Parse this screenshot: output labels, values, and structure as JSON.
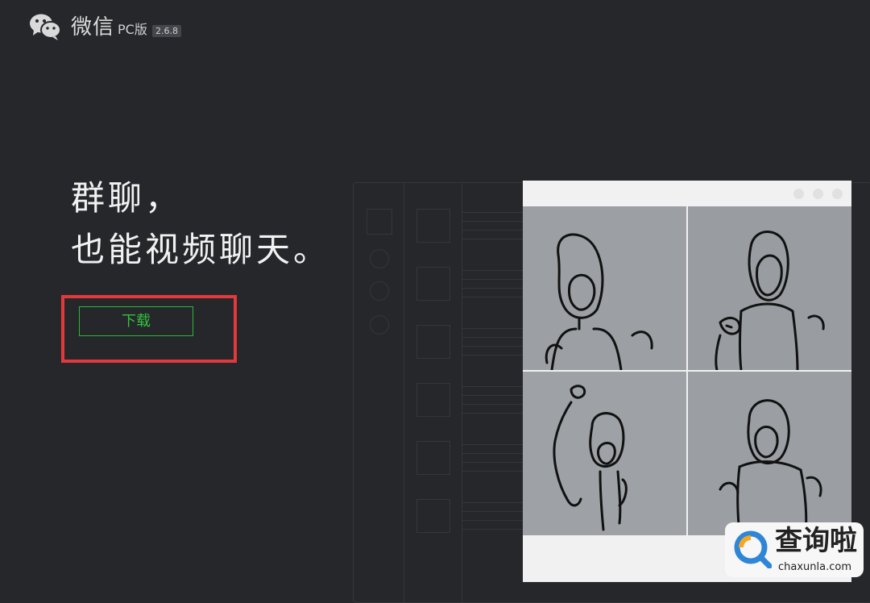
{
  "header": {
    "app_name": "微信",
    "edition": "PC版",
    "version": "2.6.8",
    "logo_icon": "wechat-logo-icon"
  },
  "hero": {
    "line1": "群聊，",
    "line2": "也能视频聊天。"
  },
  "actions": {
    "download_label": "下载",
    "highlight_color": "#e4393c",
    "button_color": "#2bb737"
  },
  "preview": {
    "window_controls": [
      "circle",
      "circle",
      "circle"
    ],
    "video_tiles": [
      "sketch-figure",
      "sketch-figure",
      "sketch-figure",
      "sketch-figure"
    ]
  },
  "watermark": {
    "title": "查询啦",
    "url": "chaxunla.com",
    "icon": "magnifier-logo-icon"
  },
  "colors": {
    "background": "#26272b",
    "text": "#f2f2f2"
  }
}
